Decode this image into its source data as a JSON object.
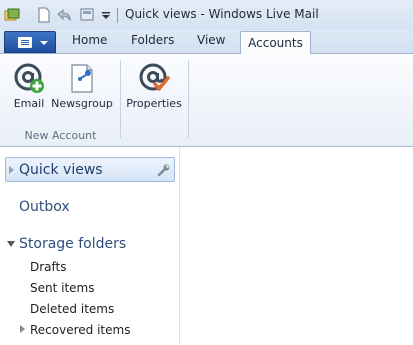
{
  "window": {
    "title": "Quick views - Windows Live Mail"
  },
  "quick_access": {
    "icons": [
      "mail-app-icon",
      "new-document-icon",
      "reply-icon",
      "send-receive-icon",
      "customize-arrow-icon"
    ]
  },
  "tabs": {
    "app_menu": "app-menu-button",
    "items": [
      {
        "label": "Home",
        "active": false
      },
      {
        "label": "Folders",
        "active": false
      },
      {
        "label": "View",
        "active": false
      },
      {
        "label": "Accounts",
        "active": true
      }
    ]
  },
  "ribbon": {
    "buttons": [
      {
        "label": "Email",
        "icon": "email-account-add-icon"
      },
      {
        "label": "Newsgroup",
        "icon": "newsgroup-icon"
      },
      {
        "label": "Properties",
        "icon": "account-properties-icon"
      }
    ],
    "group_label": "New Account"
  },
  "sidebar": {
    "quick_views": "Quick views",
    "outbox": "Outbox",
    "storage_folders": "Storage folders",
    "folders": [
      {
        "label": "Drafts"
      },
      {
        "label": "Sent items"
      },
      {
        "label": "Deleted items"
      },
      {
        "label": "Recovered items"
      }
    ]
  },
  "colors": {
    "accent": "#2e4f7d",
    "selection": "#d6e4f7",
    "ribbon_bg": "#e9eff8"
  }
}
